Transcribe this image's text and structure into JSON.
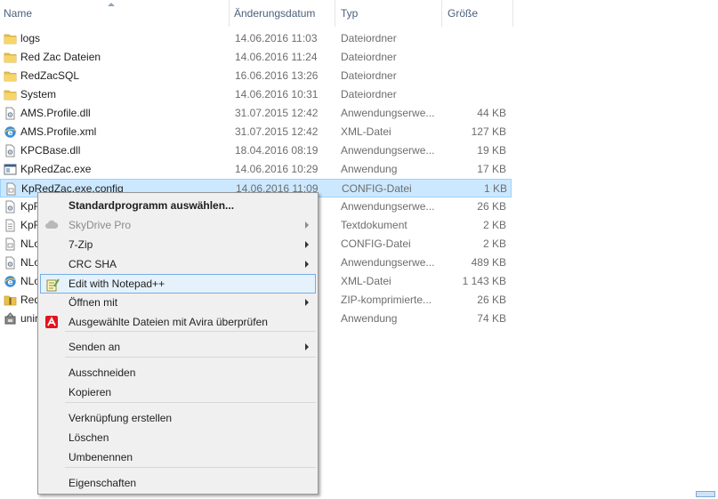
{
  "columns": {
    "name": "Name",
    "date": "Änderungsdatum",
    "type": "Typ",
    "size": "Größe"
  },
  "files": [
    {
      "name": "logs",
      "date": "14.06.2016 11:03",
      "type": "Dateiordner",
      "size": "",
      "icon": "folder-icon"
    },
    {
      "name": "Red Zac Dateien",
      "date": "14.06.2016 11:24",
      "type": "Dateiordner",
      "size": "",
      "icon": "folder-icon"
    },
    {
      "name": "RedZacSQL",
      "date": "16.06.2016 13:26",
      "type": "Dateiordner",
      "size": "",
      "icon": "folder-icon"
    },
    {
      "name": "System",
      "date": "14.06.2016 10:31",
      "type": "Dateiordner",
      "size": "",
      "icon": "folder-icon"
    },
    {
      "name": "AMS.Profile.dll",
      "date": "31.07.2015 12:42",
      "type": "Anwendungserwe...",
      "size": "44 KB",
      "icon": "dll-file-icon"
    },
    {
      "name": "AMS.Profile.xml",
      "date": "31.07.2015 12:42",
      "type": "XML-Datei",
      "size": "127 KB",
      "icon": "xml-file-icon"
    },
    {
      "name": "KPCBase.dll",
      "date": "18.04.2016 08:19",
      "type": "Anwendungserwe...",
      "size": "19 KB",
      "icon": "dll-file-icon"
    },
    {
      "name": "KpRedZac.exe",
      "date": "14.06.2016 10:29",
      "type": "Anwendung",
      "size": "17 KB",
      "icon": "exe-file-icon"
    },
    {
      "name": "KpRedZac.exe.config",
      "date": "14.06.2016 11:09",
      "type": "CONFIG-Datei",
      "size": "1 KB",
      "icon": "config-file-icon",
      "selected": true
    },
    {
      "name": "KpR",
      "date": "",
      "type": "Anwendungserwe...",
      "size": "26 KB",
      "icon": "dll-file-icon"
    },
    {
      "name": "KpR",
      "date": "",
      "type": "Textdokument",
      "size": "2 KB",
      "icon": "text-file-icon"
    },
    {
      "name": "NLo",
      "date": "",
      "type": "CONFIG-Datei",
      "size": "2 KB",
      "icon": "config-file-icon"
    },
    {
      "name": "NLo",
      "date": "",
      "type": "Anwendungserwe...",
      "size": "489 KB",
      "icon": "dll-file-icon"
    },
    {
      "name": "NLo",
      "date": "",
      "type": "XML-Datei",
      "size": "1 143 KB",
      "icon": "xml-file-icon"
    },
    {
      "name": "Red",
      "date": "",
      "type": "ZIP-komprimierte...",
      "size": "26 KB",
      "icon": "zip-file-icon"
    },
    {
      "name": "unir",
      "date": "",
      "type": "Anwendung",
      "size": "74 KB",
      "icon": "installer-file-icon"
    }
  ],
  "context_menu": {
    "items": [
      {
        "label": "Standardprogramm auswählen...",
        "bold": true
      },
      {
        "label": "SkyDrive Pro",
        "disabled": true,
        "submenu": true,
        "icon": "cloud-icon"
      },
      {
        "label": "7-Zip",
        "submenu": true
      },
      {
        "label": "CRC SHA",
        "submenu": true
      },
      {
        "label": "Edit with Notepad++",
        "hover": true,
        "icon": "notepadpp-icon"
      },
      {
        "label": "Öffnen mit",
        "submenu": true
      },
      {
        "label": "Ausgewählte Dateien mit Avira überprüfen",
        "icon": "avira-icon"
      },
      {
        "label": "Senden an",
        "submenu": true
      },
      {
        "label": "Ausschneiden"
      },
      {
        "label": "Kopieren"
      },
      {
        "label": "Verknüpfung erstellen"
      },
      {
        "label": "Löschen"
      },
      {
        "label": "Umbenennen"
      },
      {
        "label": "Eigenschaften"
      }
    ]
  },
  "colors": {
    "selection_bg": "#cce8ff",
    "selection_border": "#99d1ff",
    "menu_bg": "#f0f0f0",
    "menu_hover_border": "#78aee5",
    "folder": "#e8c04a",
    "avira": "#e3141b"
  }
}
